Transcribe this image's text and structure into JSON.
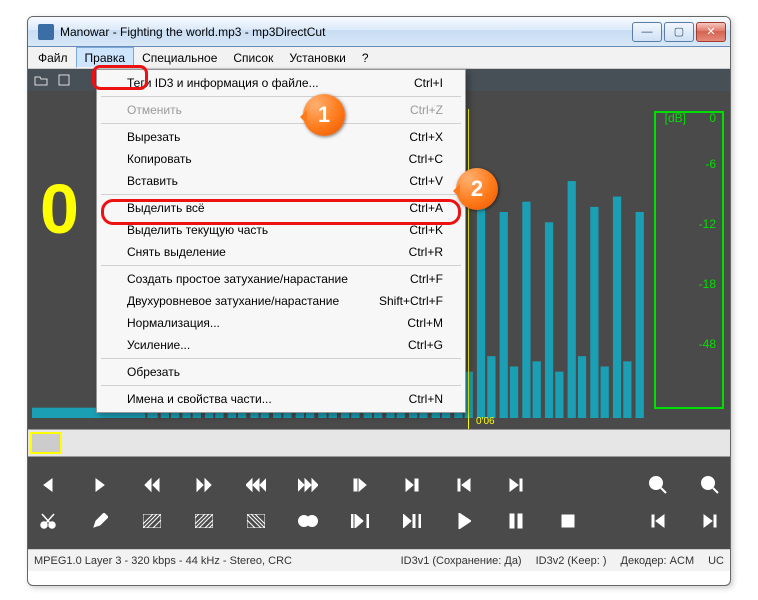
{
  "window": {
    "title": "Manowar - Fighting the world.mp3 - mp3DirectCut",
    "min": "—",
    "max": "▢",
    "close": "✕"
  },
  "menubar": [
    "Файл",
    "Правка",
    "Специальное",
    "Список",
    "Установки",
    "?"
  ],
  "popup": {
    "items": [
      {
        "label": "Теги ID3 и информация о файле...",
        "shortcut": "Ctrl+I",
        "disabled": false
      },
      {
        "sep": true
      },
      {
        "label": "Отменить",
        "shortcut": "Ctrl+Z",
        "disabled": true
      },
      {
        "sep": true
      },
      {
        "label": "Вырезать",
        "shortcut": "Ctrl+X",
        "disabled": false
      },
      {
        "label": "Копировать",
        "shortcut": "Ctrl+C",
        "disabled": false
      },
      {
        "label": "Вставить",
        "shortcut": "Ctrl+V",
        "disabled": false
      },
      {
        "sep": true
      },
      {
        "label": "Выделить всё",
        "shortcut": "Ctrl+A",
        "disabled": false,
        "highlight": true
      },
      {
        "label": "Выделить текущую часть",
        "shortcut": "Ctrl+K",
        "disabled": false
      },
      {
        "label": "Снять выделение",
        "shortcut": "Ctrl+R",
        "disabled": false
      },
      {
        "sep": true
      },
      {
        "label": "Создать простое затухание/нарастание",
        "shortcut": "Ctrl+F",
        "disabled": false
      },
      {
        "label": "Двухуровневое затухание/нарастание",
        "shortcut": "Shift+Ctrl+F",
        "disabled": false
      },
      {
        "label": "Нормализация...",
        "shortcut": "Ctrl+M",
        "disabled": false
      },
      {
        "label": "Усиление...",
        "shortcut": "Ctrl+G",
        "disabled": false
      },
      {
        "sep": true
      },
      {
        "label": "Обрезать",
        "shortcut": "",
        "disabled": false
      },
      {
        "sep": true
      },
      {
        "label": "Имена и свойства части...",
        "shortcut": "Ctrl+N",
        "disabled": false
      }
    ]
  },
  "db": {
    "label": "[dB]",
    "ticks": [
      "0",
      "-6",
      "-12",
      "-18",
      "-48"
    ]
  },
  "playtime": "0'06",
  "big": "0",
  "status": {
    "codec": "MPEG1.0 Layer 3 - 320 kbps - 44 kHz - Stereo, CRC",
    "id3v1": "ID3v1 (Сохранение: Да)",
    "id3v2": "ID3v2 (Keep: )",
    "decoder": "Декодер: ACM",
    "extra": "UC"
  },
  "callouts": {
    "one": "1",
    "two": "2"
  }
}
